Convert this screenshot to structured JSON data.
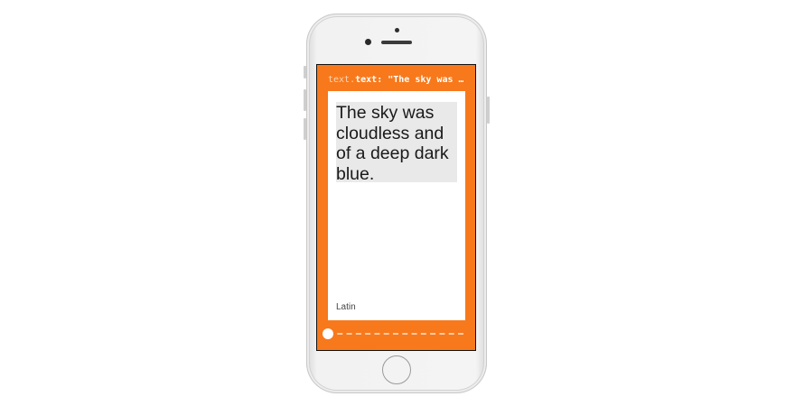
{
  "screen": {
    "code_label": {
      "prefix": "text.",
      "main": "text: \"The sky was …"
    },
    "card": {
      "text": "The sky was cloudless and of a deep dark blue.",
      "language": "Latin"
    },
    "slider": {
      "value": 0
    }
  },
  "colors": {
    "screen_background": "#f7791c",
    "card_background": "#ffffff",
    "text_highlight": "#e9e9e9"
  }
}
